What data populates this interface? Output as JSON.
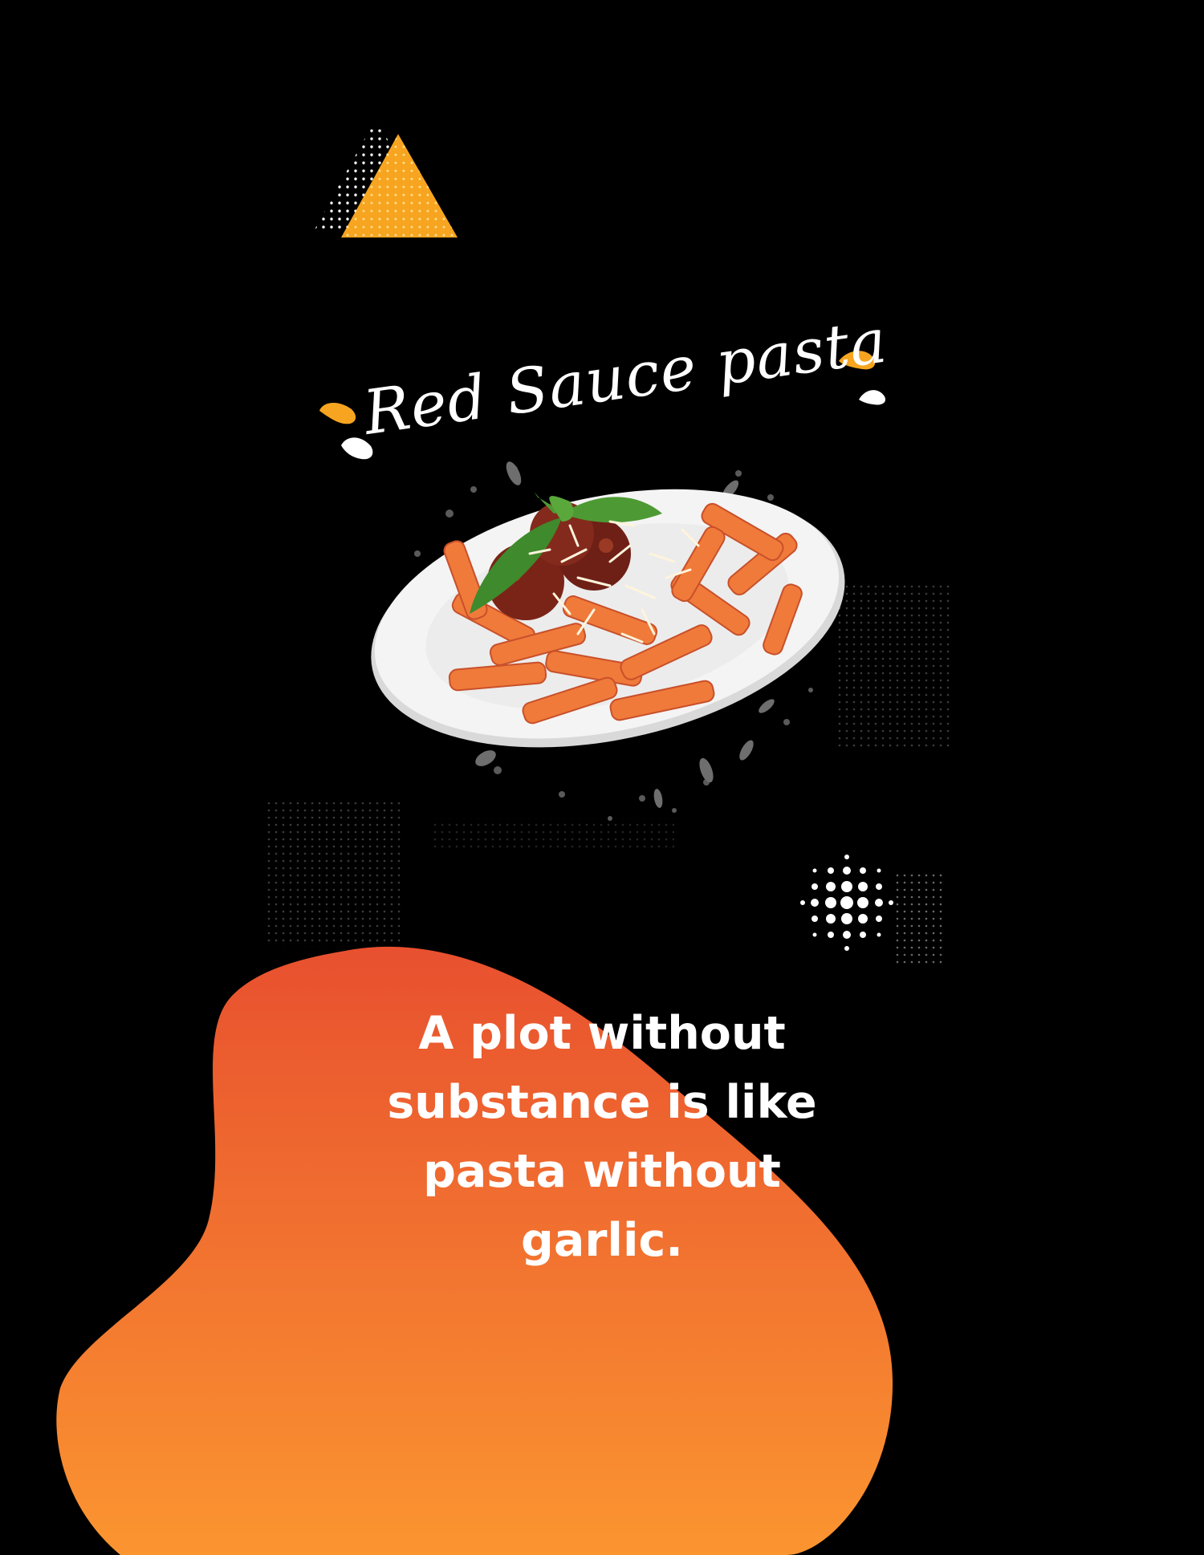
{
  "poster": {
    "title": "Red Sauce pasta",
    "quote_lines": [
      "A plot without",
      "substance is like",
      "pasta without",
      "garlic."
    ]
  },
  "colors": {
    "background": "#000000",
    "accent_orange": "#f7a520",
    "blob_top": "#e8502f",
    "blob_bottom": "#fb9530",
    "text": "#ffffff"
  },
  "icons": {
    "triangle": "triangle-icon",
    "splash": "splash-drop-icon",
    "halftone": "halftone-dots-icon"
  }
}
